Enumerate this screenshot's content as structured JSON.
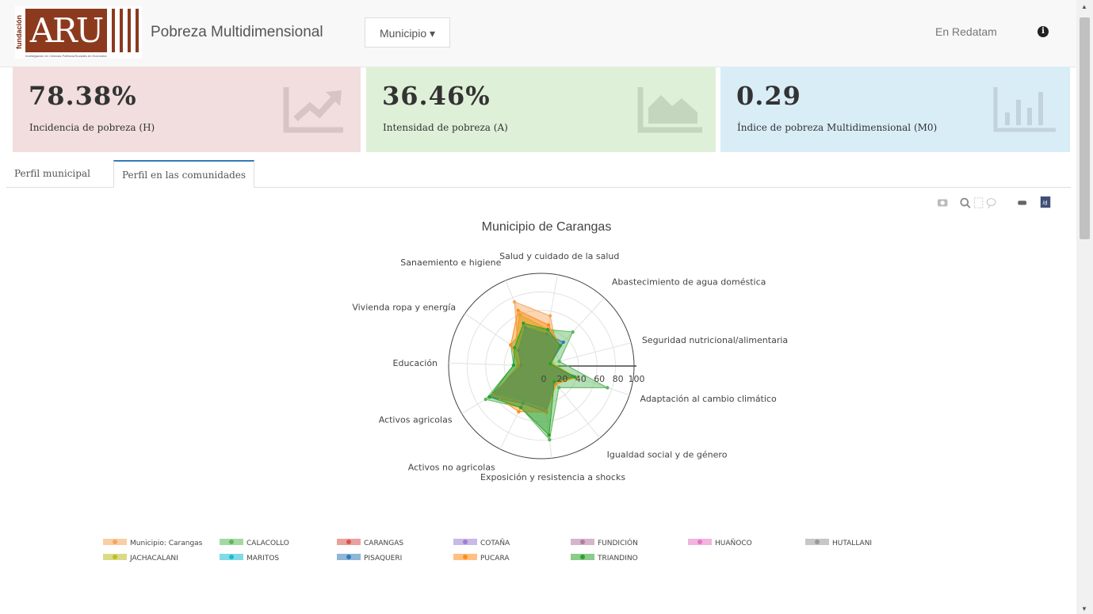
{
  "navbar": {
    "logo_vertical": "fundación",
    "logo_main": "ARU",
    "logo_sub": "Investigación en Ciencias Políticas/Sociales en Economía",
    "title": "Pobreza Multidimensional",
    "dropdown_label": "Municipio ▾",
    "redatam_link": "En Redatam",
    "info_glyph": "i"
  },
  "stats": [
    {
      "value": "78.38%",
      "label": "Incidencia de pobreza (H)",
      "bg": "#f2dede",
      "icon": "trend-up-icon"
    },
    {
      "value": "36.46%",
      "label": "Intensidad de pobreza (A)",
      "bg": "#dff0d8",
      "icon": "area-chart-icon"
    },
    {
      "value": "0.29",
      "label": "Índice de pobreza Multidimensional (M0)",
      "bg": "#d9edf7",
      "icon": "bar-chart-icon"
    }
  ],
  "tabs": [
    {
      "label": "Perfil municipal"
    },
    {
      "label": "Perfil en las comunidades"
    }
  ],
  "modebar": [
    "camera-icon",
    "zoom-icon",
    "select-box-icon",
    "lasso-icon",
    "pan-icon",
    "plotly-logo-icon"
  ],
  "chart_data": {
    "type": "radar",
    "title": "Municipio de Carangas",
    "axes": [
      "Salud y cuidado de la salud",
      "Abastecimiento de agua doméstica",
      "Seguridad nutricional/alimentaria",
      "Adaptación al cambio climático",
      "Igualdad social y de género",
      "Exposición y resistencia a shocks",
      "Activos no agricolas",
      "Activos agricolas",
      "Educación",
      "Vivienda ropa y energía",
      "Sanaemiento e higiene"
    ],
    "radial_ticks": [
      "0",
      "20",
      "40",
      "60",
      "80",
      "100"
    ],
    "radial_range": [
      0,
      100
    ],
    "series": [
      {
        "name": "Municipio: Carangas",
        "color": "#f5a55b",
        "values": [
          55,
          25,
          8,
          40,
          20,
          45,
          40,
          55,
          20,
          30,
          75
        ]
      },
      {
        "name": "CALACOLLO",
        "color": "#5cb85c",
        "values": [
          40,
          50,
          20,
          75,
          30,
          80,
          50,
          70,
          30,
          40,
          45
        ]
      },
      {
        "name": "CARANGAS",
        "color": "#d9534f",
        "values": [
          30,
          20,
          10,
          30,
          15,
          40,
          35,
          50,
          15,
          25,
          40
        ]
      },
      {
        "name": "COTAÑA",
        "color": "#9b7fd4",
        "values": [
          35,
          25,
          12,
          35,
          20,
          45,
          40,
          55,
          20,
          30,
          45
        ]
      },
      {
        "name": "FUNDICIÓN",
        "color": "#b07aa1",
        "values": [
          30,
          22,
          10,
          30,
          18,
          40,
          38,
          50,
          18,
          28,
          40
        ]
      },
      {
        "name": "HUAÑOCO",
        "color": "#e377c2",
        "values": [
          32,
          24,
          10,
          32,
          20,
          42,
          38,
          52,
          20,
          28,
          42
        ]
      },
      {
        "name": "HUTALLANI",
        "color": "#999999",
        "values": [
          30,
          20,
          10,
          30,
          18,
          40,
          36,
          50,
          18,
          26,
          40
        ]
      },
      {
        "name": "JACHACALANI",
        "color": "#bcbd22",
        "values": [
          40,
          30,
          12,
          40,
          25,
          50,
          45,
          60,
          25,
          35,
          60
        ]
      },
      {
        "name": "MARITOS",
        "color": "#17becf",
        "values": [
          35,
          30,
          10,
          35,
          22,
          45,
          42,
          58,
          22,
          30,
          45
        ]
      },
      {
        "name": "PISAQUERI",
        "color": "#337ab7",
        "values": [
          35,
          35,
          10,
          35,
          22,
          50,
          45,
          65,
          22,
          30,
          45
        ]
      },
      {
        "name": "PUCARA",
        "color": "#ff8c1a",
        "values": [
          45,
          30,
          10,
          38,
          25,
          50,
          55,
          60,
          25,
          40,
          65
        ]
      },
      {
        "name": "TRIANDINO",
        "color": "#2ca02c",
        "values": [
          40,
          30,
          10,
          38,
          22,
          75,
          50,
          65,
          30,
          35,
          50
        ]
      }
    ]
  }
}
